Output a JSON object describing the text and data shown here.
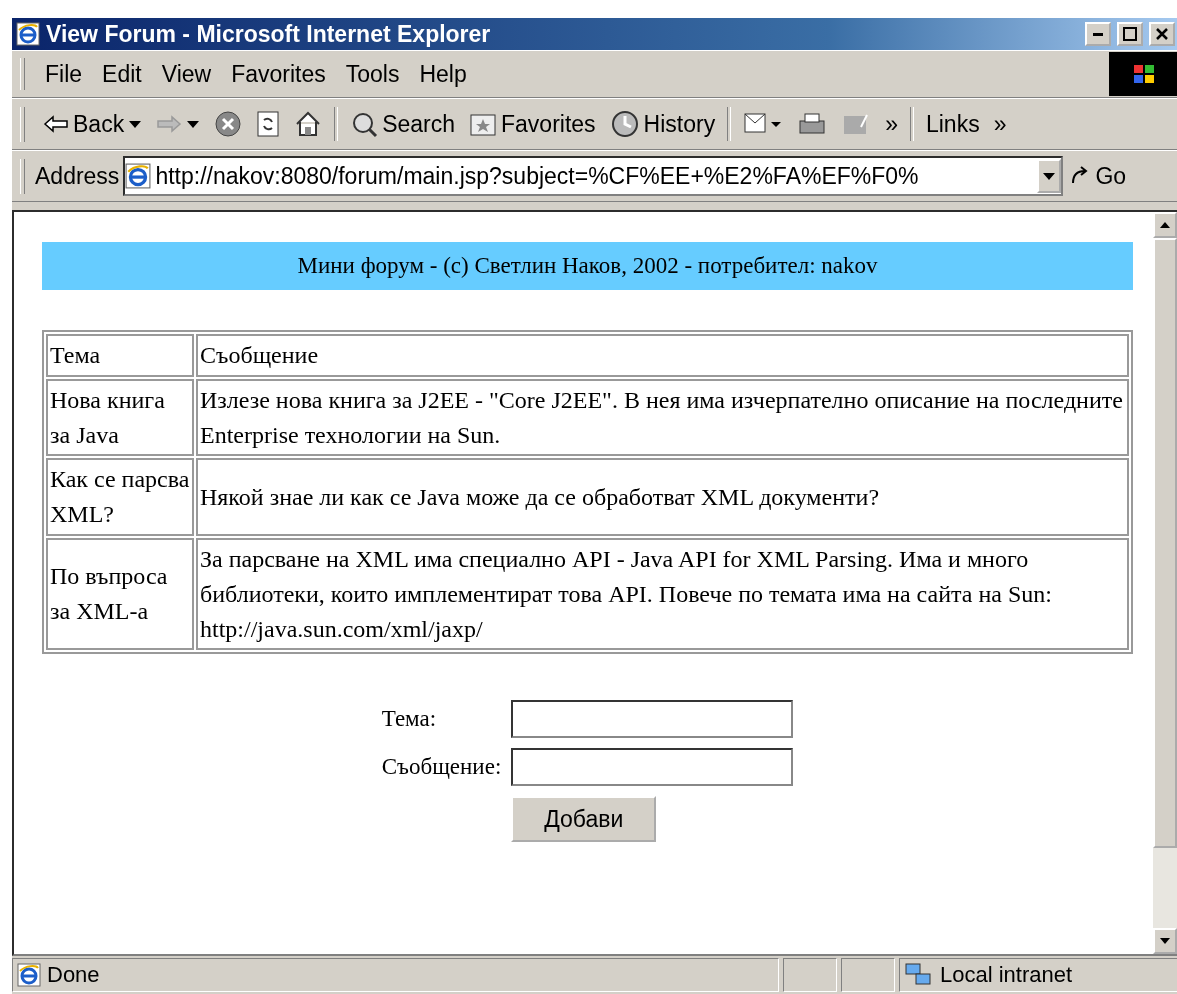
{
  "window": {
    "title": "View Forum - Microsoft Internet Explorer"
  },
  "menu": [
    "File",
    "Edit",
    "View",
    "Favorites",
    "Tools",
    "Help"
  ],
  "toolbar": [
    {
      "kind": "back",
      "label": "Back",
      "disabled": false
    },
    {
      "kind": "forward",
      "disabled": true
    },
    {
      "kind": "stop",
      "disabled": false
    },
    {
      "kind": "refresh",
      "disabled": false
    },
    {
      "kind": "home",
      "disabled": false
    },
    {
      "kind": "search",
      "label": "Search",
      "disabled": false
    },
    {
      "kind": "favorites",
      "label": "Favorites",
      "disabled": false
    },
    {
      "kind": "history",
      "label": "History",
      "disabled": false
    },
    {
      "kind": "mail",
      "disabled": false
    },
    {
      "kind": "print",
      "disabled": false
    },
    {
      "kind": "edit",
      "disabled": true
    }
  ],
  "toolbar_more": "»",
  "links": {
    "label": "Links",
    "more": "»"
  },
  "address": {
    "label": "Address",
    "value": "http://nakov:8080/forum/main.jsp?subject=%CF%EE+%E2%FA%EF%F0%",
    "go": "Go"
  },
  "page": {
    "header": "Мини форум - (c) Светлин Наков, 2002 - потребител: nakov",
    "table": {
      "columns": [
        "Тема",
        "Съобщение"
      ],
      "rows": [
        [
          "Нова книга за Java",
          "Излезе нова книга за J2EE - \"Core J2EE\". В нея има изчерпателно описание на последните Enterprise технологии на Sun."
        ],
        [
          "Как се парсва XML?",
          "Някой знае ли как се Java може да се обработват XML документи?"
        ],
        [
          "По въпроса за XML-а",
          "За парсване на XML има специално API - Java API for XML Parsing. Има и много библиотеки, които имплементират това API. Повече по темата има на сайта на Sun: http://java.sun.com/xml/jaxp/"
        ]
      ]
    },
    "form": {
      "fields": [
        {
          "label": "Тема:"
        },
        {
          "label": "Съобщение:"
        }
      ],
      "submit": "Добави"
    }
  },
  "status_bar": {
    "text": "Done",
    "zone": "Local intranet"
  }
}
